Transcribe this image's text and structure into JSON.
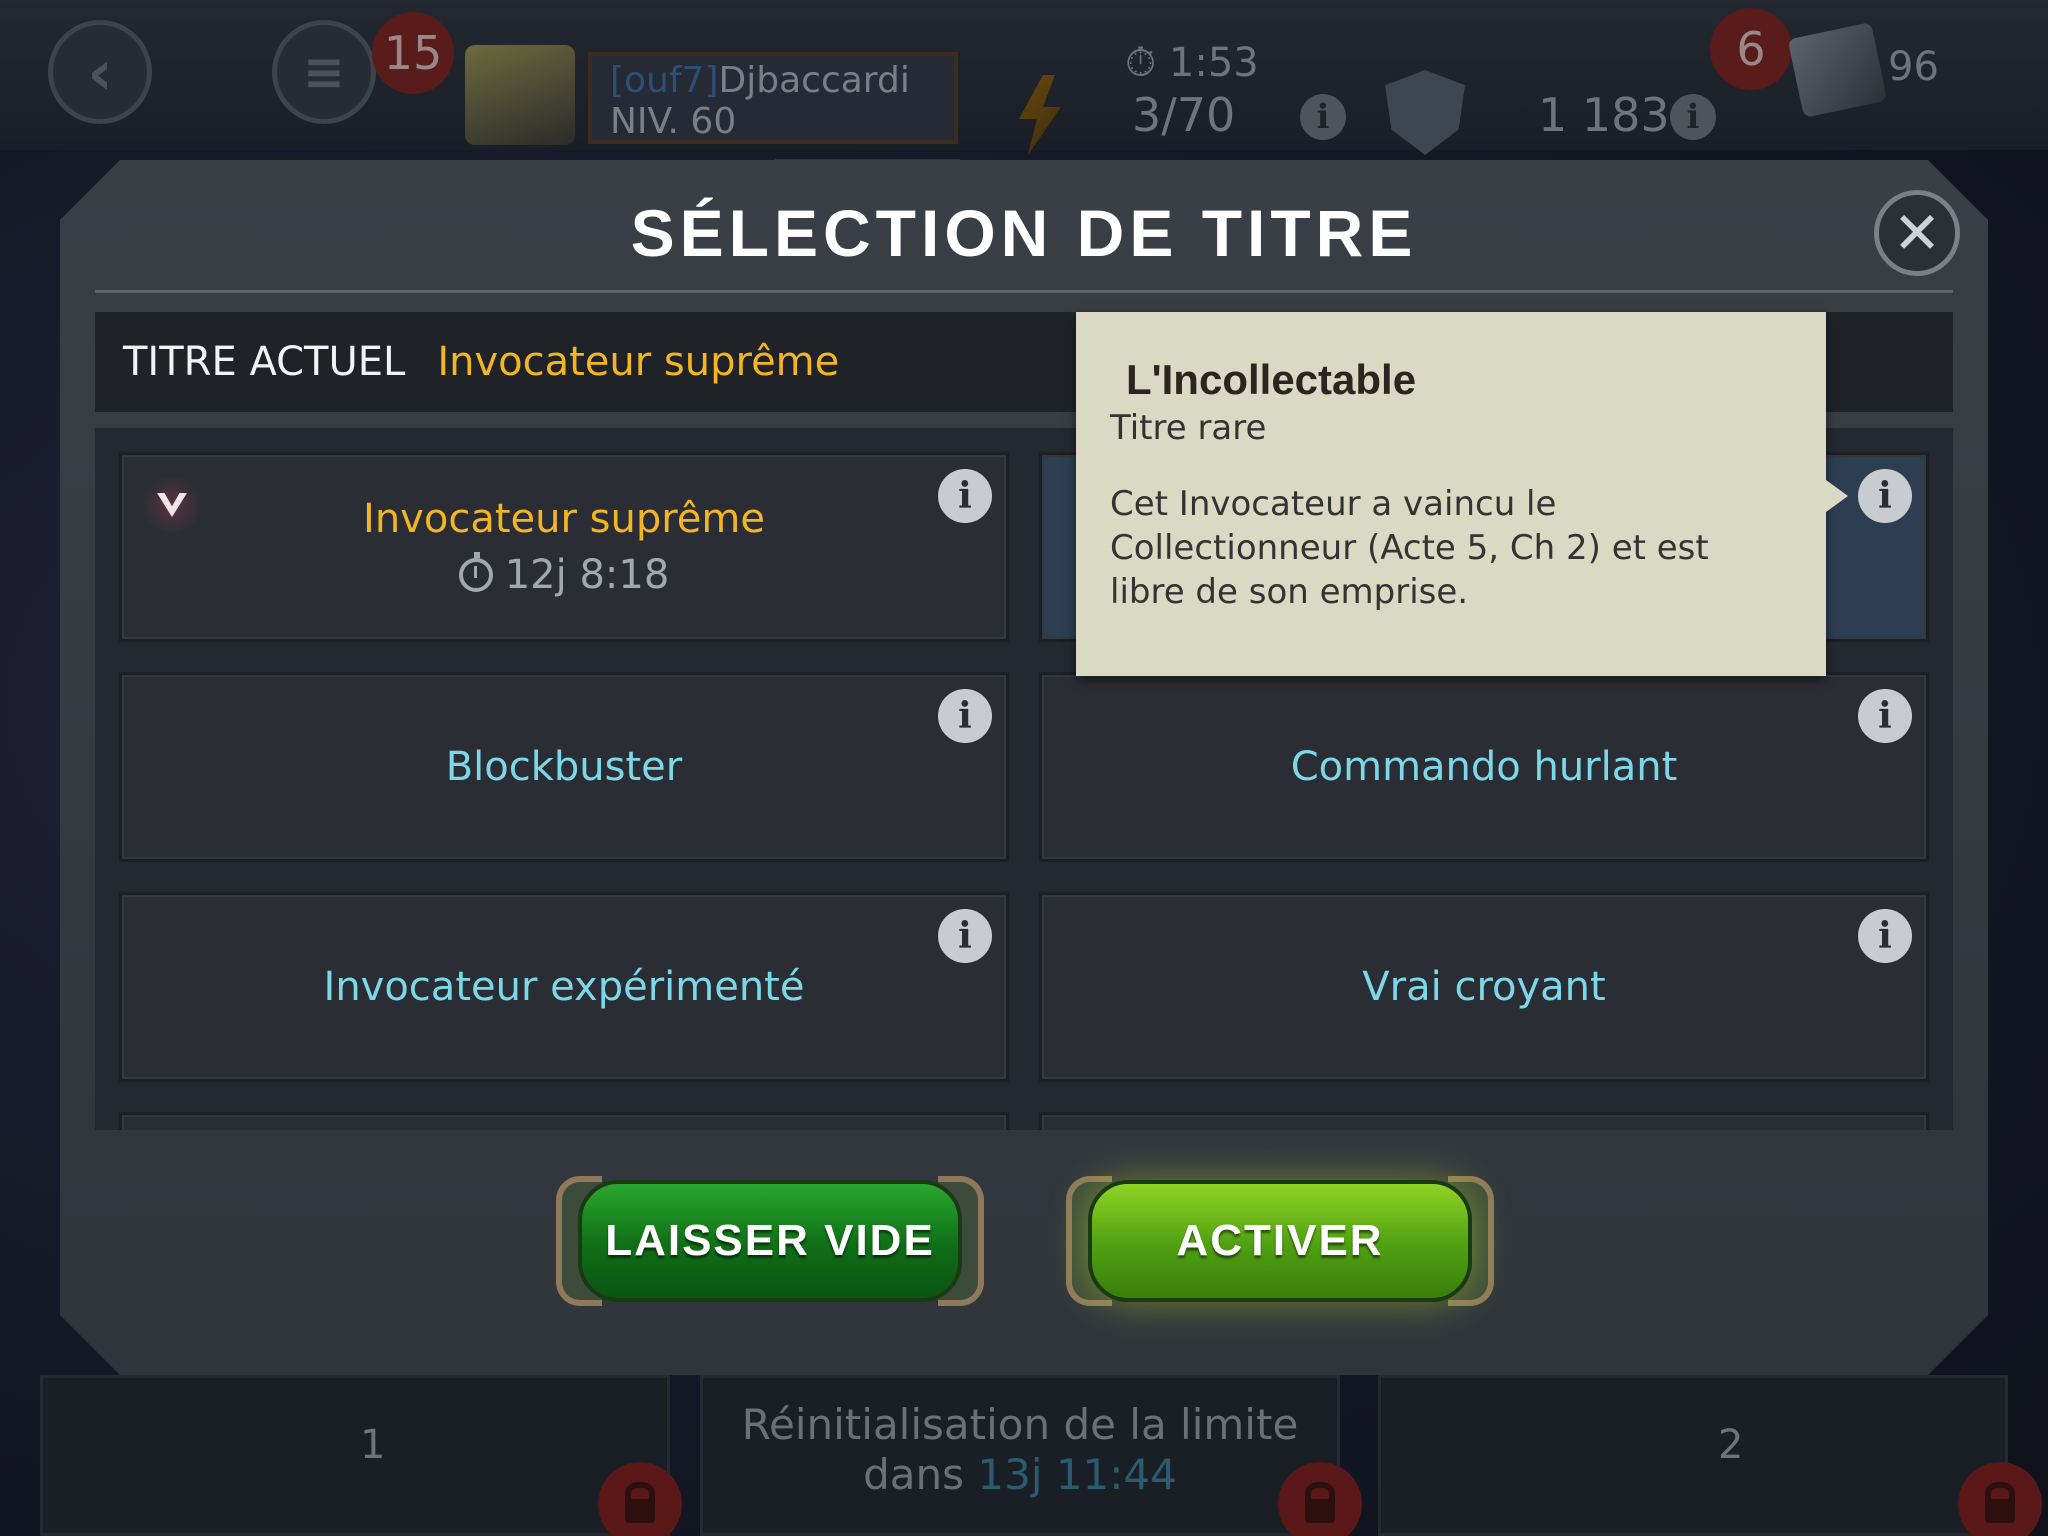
{
  "hud": {
    "notifications_count": "15",
    "player": {
      "tag": "[ouf7]",
      "name": "Djbaccardi",
      "level": "NIV. 60"
    },
    "energy": {
      "timer": "1:53",
      "value": "3/70"
    },
    "alliance_points": "1 183",
    "crystal_badge": "6",
    "crystal_count": "96"
  },
  "modal": {
    "title": "SÉLECTION DE TITRE",
    "current_title_label": "TITRE ACTUEL",
    "current_title_value": "Invocateur suprême"
  },
  "titles": [
    {
      "name": "Invocateur suprême",
      "timer": "12j 8:18"
    },
    {
      "name": "Blockbuster"
    },
    {
      "name": "Commando hurlant"
    },
    {
      "name": "Invocateur expérimenté"
    },
    {
      "name": "Vrai croyant"
    }
  ],
  "tooltip": {
    "title": "L'Incollectable",
    "subtitle": "Titre rare",
    "description": "Cet Invocateur a vaincu le Collectionneur (Acte 5, Ch 2) et est libre de son emprise."
  },
  "buttons": {
    "leave_empty": "LAISSER VIDE",
    "activate": "ACTIVER"
  },
  "footer": {
    "left_count": "1",
    "right_count": "2",
    "reset_text": "Réinitialisation de la limite",
    "reset_prefix": "dans",
    "reset_timer": "13j 11:44"
  }
}
